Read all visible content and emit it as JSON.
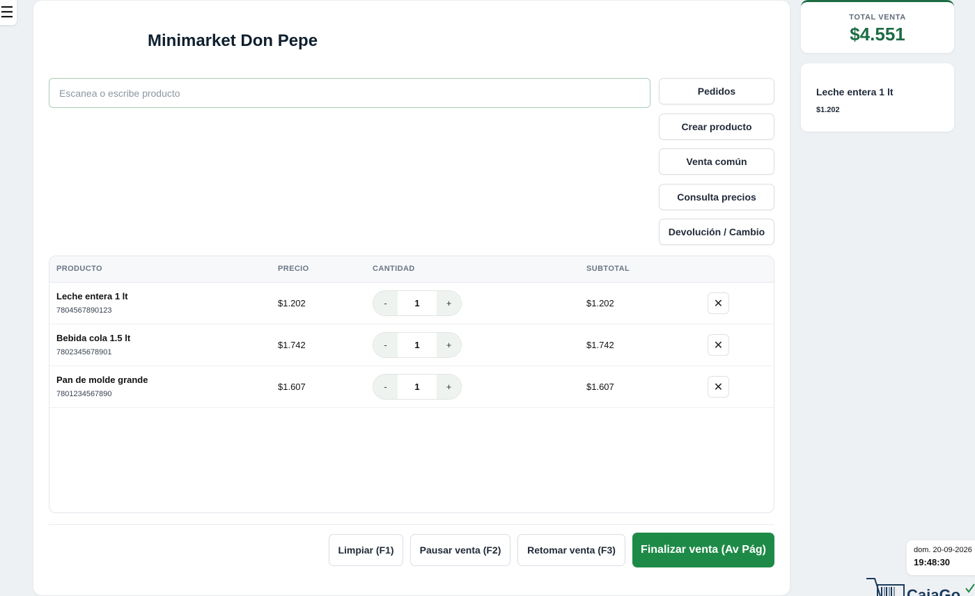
{
  "menu": {
    "icon": "hamburger-icon",
    "glyph": "☰"
  },
  "store": {
    "title": "Minimarket Don Pepe"
  },
  "search": {
    "placeholder": "Escanea o escribe producto",
    "value": ""
  },
  "actions": [
    {
      "label": "Pedidos"
    },
    {
      "label": "Crear producto"
    },
    {
      "label": "Venta común"
    },
    {
      "label": "Consulta precios"
    },
    {
      "label": "Devolución / Cambio"
    }
  ],
  "table": {
    "headers": {
      "product": "PRODUCTO",
      "price": "PRECIO",
      "quantity": "CANTIDAD",
      "subtotal": "SUBTOTAL"
    },
    "rows": [
      {
        "name": "Leche entera 1 lt",
        "code": "7804567890123",
        "price": "$1.202",
        "qty": "1",
        "subtotal": "$1.202"
      },
      {
        "name": "Bebida cola 1.5 lt",
        "code": "7802345678901",
        "price": "$1.742",
        "qty": "1",
        "subtotal": "$1.742"
      },
      {
        "name": "Pan de molde grande",
        "code": "7801234567890",
        "price": "$1.607",
        "qty": "1",
        "subtotal": "$1.607"
      }
    ],
    "minus_label": "-",
    "plus_label": "+",
    "remove_glyph": "✕"
  },
  "footer": {
    "clear": "Limpiar (F1)",
    "pause": "Pausar venta (F2)",
    "resume": "Retomar venta (F3)",
    "finish": "Finalizar venta (Av Pág)"
  },
  "total": {
    "label": "TOTAL VENTA",
    "value": "$4.551"
  },
  "last_item": {
    "name": "Leche entera 1 lt",
    "price": "$1.202"
  },
  "clock": {
    "date": "dom. 20-09-2026",
    "time": "19:48:30"
  },
  "logo": {
    "text": "CajaGo"
  },
  "colors": {
    "accent": "#1e8a47",
    "accent_dark": "#1c6b43",
    "logo": "#1b3a5c"
  }
}
